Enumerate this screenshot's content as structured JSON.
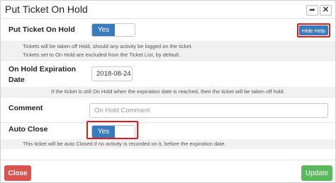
{
  "modal": {
    "title": "Put Ticket On Hold",
    "share_icon": "share-arrow-icon",
    "close_icon": "close-icon",
    "share_glyph": "➦",
    "close_glyph": "✕"
  },
  "put_on_hold": {
    "label": "Put Ticket On Hold",
    "toggle_value": "Yes",
    "hide_help_label": "Hide Help",
    "help_lines": [
      "Tickets will be taken off Hold, should any activity be logged on the ticket.",
      "Tickets set to On Hold are excluded from the Ticket List, by default."
    ]
  },
  "expiration": {
    "label_line1": "On Hold Expiration",
    "label_line2": "Date",
    "value": "2018-08-24",
    "help": "If the ticket is still On Hold when the expiration date is reached, then the ticket will be taken off hold."
  },
  "comment": {
    "label": "Comment",
    "placeholder": "On Hold Comment",
    "value": ""
  },
  "auto_close": {
    "label": "Auto Close",
    "toggle_value": "Yes",
    "help": "This ticket will be auto Closed if no activity is recorded on it, before the expiration date."
  },
  "footer": {
    "close_label": "Close",
    "update_label": "Update"
  },
  "colors": {
    "primary": "#3a7bbf",
    "danger": "#d9534f",
    "success": "#5cb85c",
    "highlight": "#e01d1d"
  }
}
